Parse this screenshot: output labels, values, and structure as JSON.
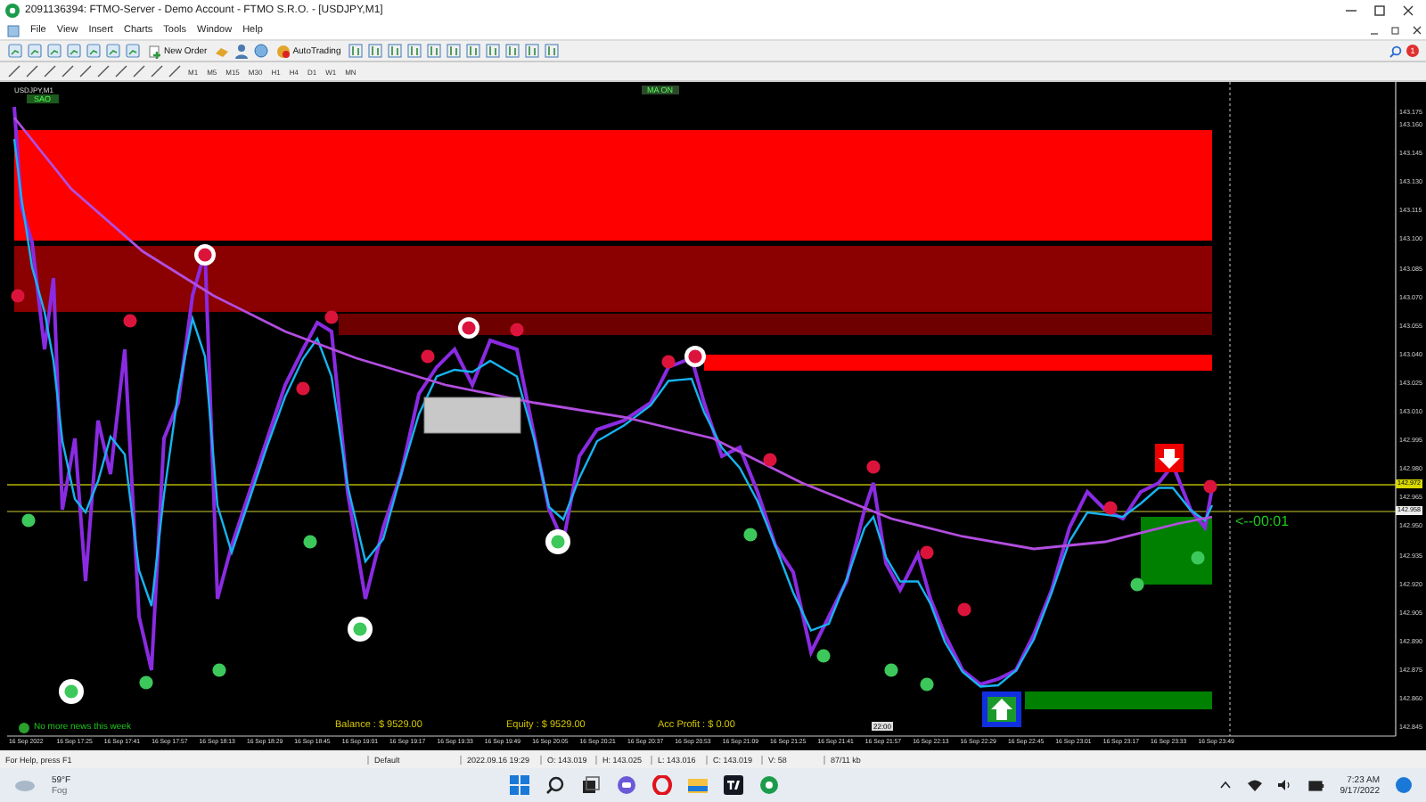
{
  "window": {
    "title": "2091136394: FTMO-Server - Demo Account - FTMO S.R.O. - [USDJPY,M1]"
  },
  "menu": [
    "File",
    "View",
    "Insert",
    "Charts",
    "Tools",
    "Window",
    "Help"
  ],
  "toolbar": {
    "new_order": "New Order",
    "autotrading": "AutoTrading",
    "notification_count": "1"
  },
  "timeframes": [
    "M1",
    "M5",
    "M15",
    "M30",
    "H1",
    "H4",
    "D1",
    "W1",
    "MN"
  ],
  "chart": {
    "symbol": "USDJPY,M1",
    "corner_badge": "SAO",
    "ma_badge": "MA ON",
    "price_labels": [
      "143.175",
      "143.160",
      "143.145",
      "143.130",
      "143.115",
      "143.100",
      "143.085",
      "143.070",
      "143.055",
      "143.040",
      "143.025",
      "143.010",
      "142.995",
      "142.980",
      "142.965",
      "142.950",
      "142.935",
      "142.920",
      "142.905",
      "142.890",
      "142.875",
      "142.860",
      "142.845"
    ],
    "ask_label": "142.972",
    "bid_label": "142.958",
    "countdown": "<--00:01",
    "time_marker": "22:00",
    "news": "No more news this week",
    "balance": "Balance : $ 9529.00",
    "equity": "Equity : $ 9529.00",
    "profit": "Acc Profit : $ 0.00",
    "time_labels": [
      "16 Sep 2022",
      "16 Sep 17:25",
      "16 Sep 17:41",
      "16 Sep 17:57",
      "16 Sep 18:13",
      "16 Sep 18:29",
      "16 Sep 18:45",
      "16 Sep 19:01",
      "16 Sep 19:17",
      "16 Sep 19:33",
      "16 Sep 19:49",
      "16 Sep 20:05",
      "16 Sep 20:21",
      "16 Sep 20:37",
      "16 Sep 20:53",
      "16 Sep 21:09",
      "16 Sep 21:25",
      "16 Sep 21:41",
      "16 Sep 21:57",
      "16 Sep 22:13",
      "16 Sep 22:29",
      "16 Sep 22:45",
      "16 Sep 23:01",
      "16 Sep 23:17",
      "16 Sep 23:33",
      "16 Sep 23:49"
    ]
  },
  "status_bar": [
    "For Help, press F1",
    "Default",
    "2022.09.16 19:29",
    "O: 143.019",
    "H: 143.025",
    "L: 143.016",
    "C: 143.019",
    "V: 58",
    "87/11 kb"
  ],
  "taskbar": {
    "temperature": "59°F",
    "weather": "Fog",
    "time": "7:23 AM",
    "date": "9/17/2022"
  }
}
